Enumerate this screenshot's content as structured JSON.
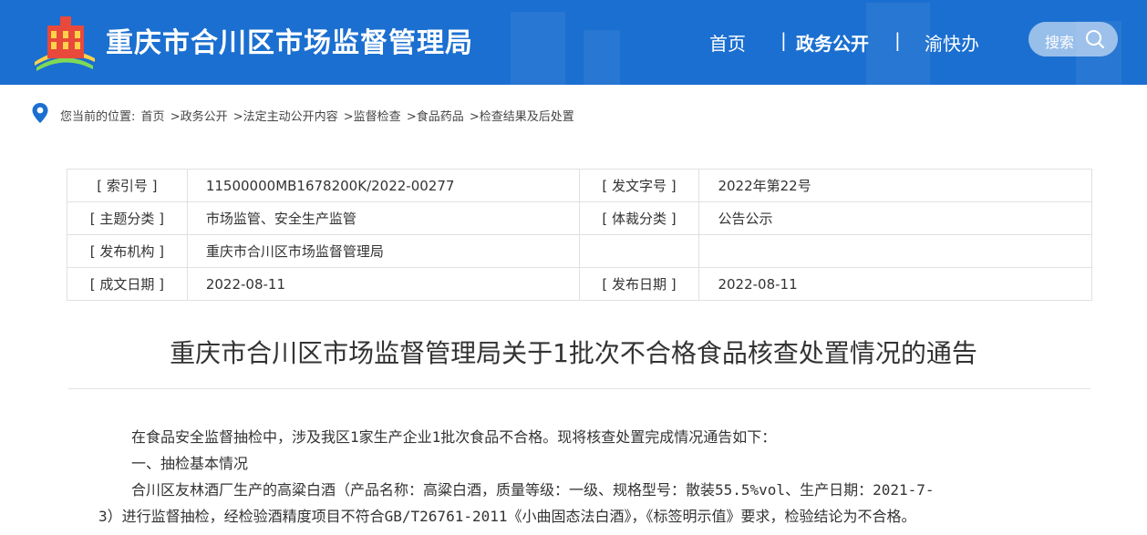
{
  "header": {
    "site_title": "重庆市合川区市场监督管理局",
    "nav": {
      "home": "首页",
      "separator": "|",
      "gov_open": "政务公开",
      "yukuaiban": "渝快办"
    },
    "search_label": "搜索",
    "colors": {
      "header_bg": "#1b6fd0"
    }
  },
  "breadcrumb": {
    "prefix": "您当前的位置:",
    "items": [
      "首页",
      ">政务公开",
      ">法定主动公开内容",
      ">监督检查",
      ">食品药品",
      ">检查结果及后处置"
    ]
  },
  "meta": {
    "rows": [
      {
        "k1": "[ 索引号 ]",
        "v1": "11500000MB1678200K/2022-00277",
        "k2": "[ 发文字号 ]",
        "v2": "2022年第22号"
      },
      {
        "k1": "[ 主题分类 ]",
        "v1": "市场监管、安全生产监管",
        "k2": "[ 体裁分类 ]",
        "v2": "公告公示"
      },
      {
        "k1": "[ 发布机构 ]",
        "v1": "重庆市合川区市场监督管理局",
        "k2": "",
        "v2": ""
      },
      {
        "k1": "[ 成文日期 ]",
        "v1": "2022-08-11",
        "k2": "[ 发布日期 ]",
        "v2": "2022-08-11"
      }
    ]
  },
  "document": {
    "title": "重庆市合川区市场监督管理局关于1批次不合格食品核查处置情况的通告",
    "paragraphs": [
      "在食品安全监督抽检中，涉及我区1家生产企业1批次食品不合格。现将核查处置完成情况通告如下：",
      "一、抽检基本情况",
      "合川区友林酒厂生产的高粱白酒（产品名称：高粱白酒，质量等级：一级、规格型号：散装55.5%vol、生产日期：2021-7-",
      "3）进行监督抽检，经检验酒精度项目不符合GB/T26761-2011《小曲固态法白酒》，《标签明示值》要求，检验结论为不合格。"
    ]
  }
}
